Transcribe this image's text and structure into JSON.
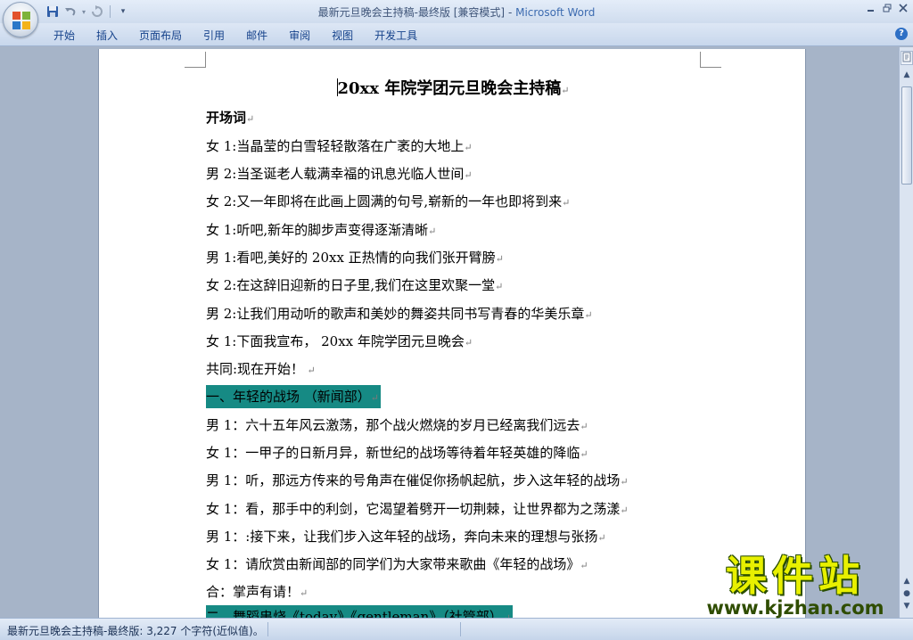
{
  "window": {
    "title_doc": "最新元旦晚会主持稿-最终版 [兼容模式]",
    "title_sep": " - ",
    "title_app": "Microsoft Word"
  },
  "ribbon": {
    "tabs": [
      "开始",
      "插入",
      "页面布局",
      "引用",
      "邮件",
      "审阅",
      "视图",
      "开发工具"
    ]
  },
  "document": {
    "title": "20xx 年院学团元旦晚会主持稿",
    "paragraphs": [
      {
        "text": "开场词",
        "style": "bold"
      },
      {
        "text": "女 1:当晶莹的白雪轻轻散落在广袤的大地上",
        "style": "normal"
      },
      {
        "text": "男 2:当圣诞老人载满幸福的讯息光临人世间",
        "style": "normal"
      },
      {
        "text": "女 2:又一年即将在此画上圆满的句号,崭新的一年也即将到来",
        "style": "normal"
      },
      {
        "text": "女 1:听吧,新年的脚步声变得逐渐清晰",
        "style": "normal"
      },
      {
        "text": "男 1:看吧,美好的 20xx 正热情的向我们张开臂膀",
        "style": "normal"
      },
      {
        "text": "女 2:在这辞旧迎新的日子里,我们在这里欢聚一堂",
        "style": "normal"
      },
      {
        "text": "男 2:让我们用动听的歌声和美妙的舞姿共同书写青春的华美乐章",
        "style": "normal"
      },
      {
        "text": "女 1:下面我宣布， 20xx 年院学团元旦晚会",
        "style": "normal"
      },
      {
        "text": "共同:现在开始！",
        "style": "normal"
      },
      {
        "text": "一、年轻的战场 （新闻部）",
        "style": "highlight"
      },
      {
        "text": "男 1：六十五年风云激荡，那个战火燃烧的岁月已经离我们远去",
        "style": "normal"
      },
      {
        "text": "女 1：一甲子的日新月异，新世纪的战场等待着年轻英雄的降临",
        "style": "normal"
      },
      {
        "text": "男 1：听，那远方传来的号角声在催促你扬帆起航，步入这年轻的战场",
        "style": "normal"
      },
      {
        "text": "女 1：看，那手中的利剑，它渴望着劈开一切荆棘，让世界都为之荡漾",
        "style": "normal"
      },
      {
        "text": "男 1：:接下来，让我们步入这年轻的战场，奔向未来的理想与张扬",
        "style": "normal"
      },
      {
        "text": "女 1：请欣赏由新闻部的同学们为大家带来歌曲《年轻的战场》",
        "style": "normal"
      },
      {
        "text": "合：掌声有请！",
        "style": "normal"
      },
      {
        "text": "二、舞蹈串烧《today》《gentleman》（社管部）",
        "style": "highlight"
      }
    ]
  },
  "statusbar": {
    "text": "最新元旦晚会主持稿-最终版: 3,227 个字符(近似值)。"
  },
  "watermark": {
    "title": "课件站",
    "url": "www.kjzhan.com"
  },
  "colors": {
    "highlight": "#168a84",
    "watermark_yellow": "#e8f000",
    "title_app_blue": "#3c6bb0"
  }
}
